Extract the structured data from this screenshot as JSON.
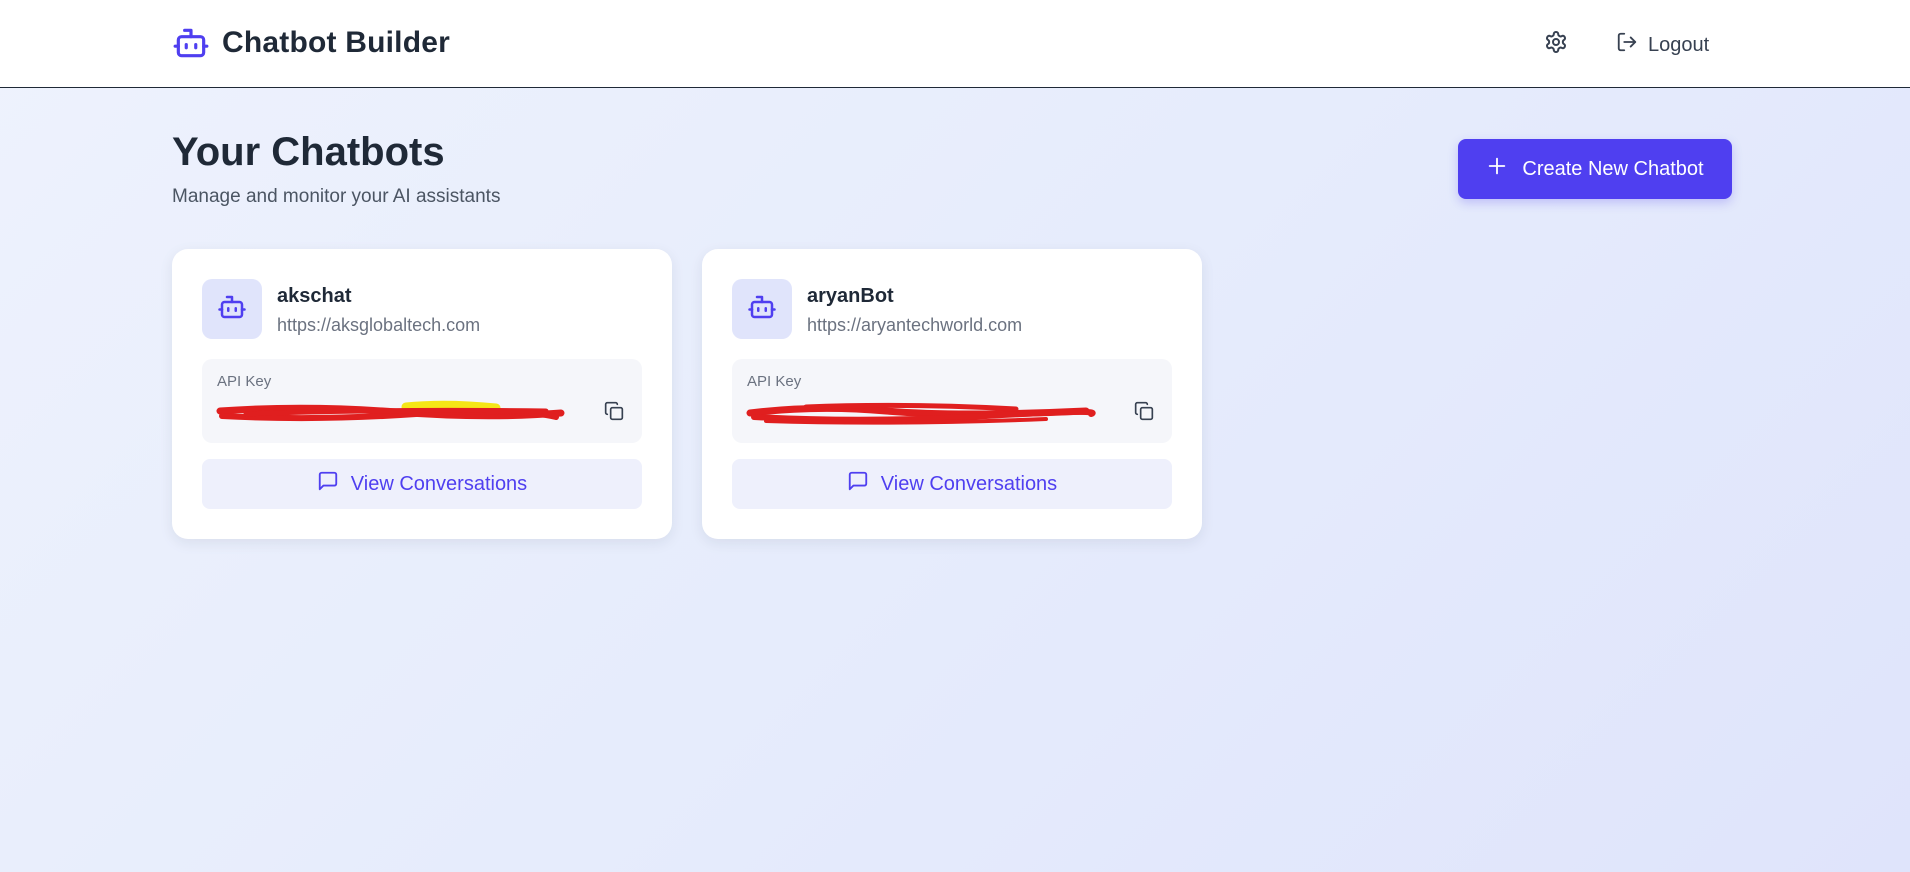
{
  "header": {
    "app_title": "Chatbot Builder",
    "brand_icon": "bot-icon",
    "settings_icon": "gear-icon",
    "logout_label": "Logout",
    "logout_icon": "logout-icon"
  },
  "page": {
    "title": "Your Chatbots",
    "subtitle": "Manage and monitor your AI assistants",
    "create_button_label": "Create New Chatbot",
    "create_button_icon": "plus-icon"
  },
  "chatbots": [
    {
      "name": "akschat",
      "url": "https://aksglobaltech.com",
      "api_key_label": "API Key",
      "api_key_value": "",
      "view_label": "View Conversations"
    },
    {
      "name": "aryanBot",
      "url": "https://aryantechworld.com",
      "api_key_label": "API Key",
      "api_key_value": "",
      "view_label": "View Conversations"
    }
  ],
  "colors": {
    "accent": "#4f3ff0",
    "redaction": "#e01f1f",
    "highlight": "#f5e616"
  }
}
